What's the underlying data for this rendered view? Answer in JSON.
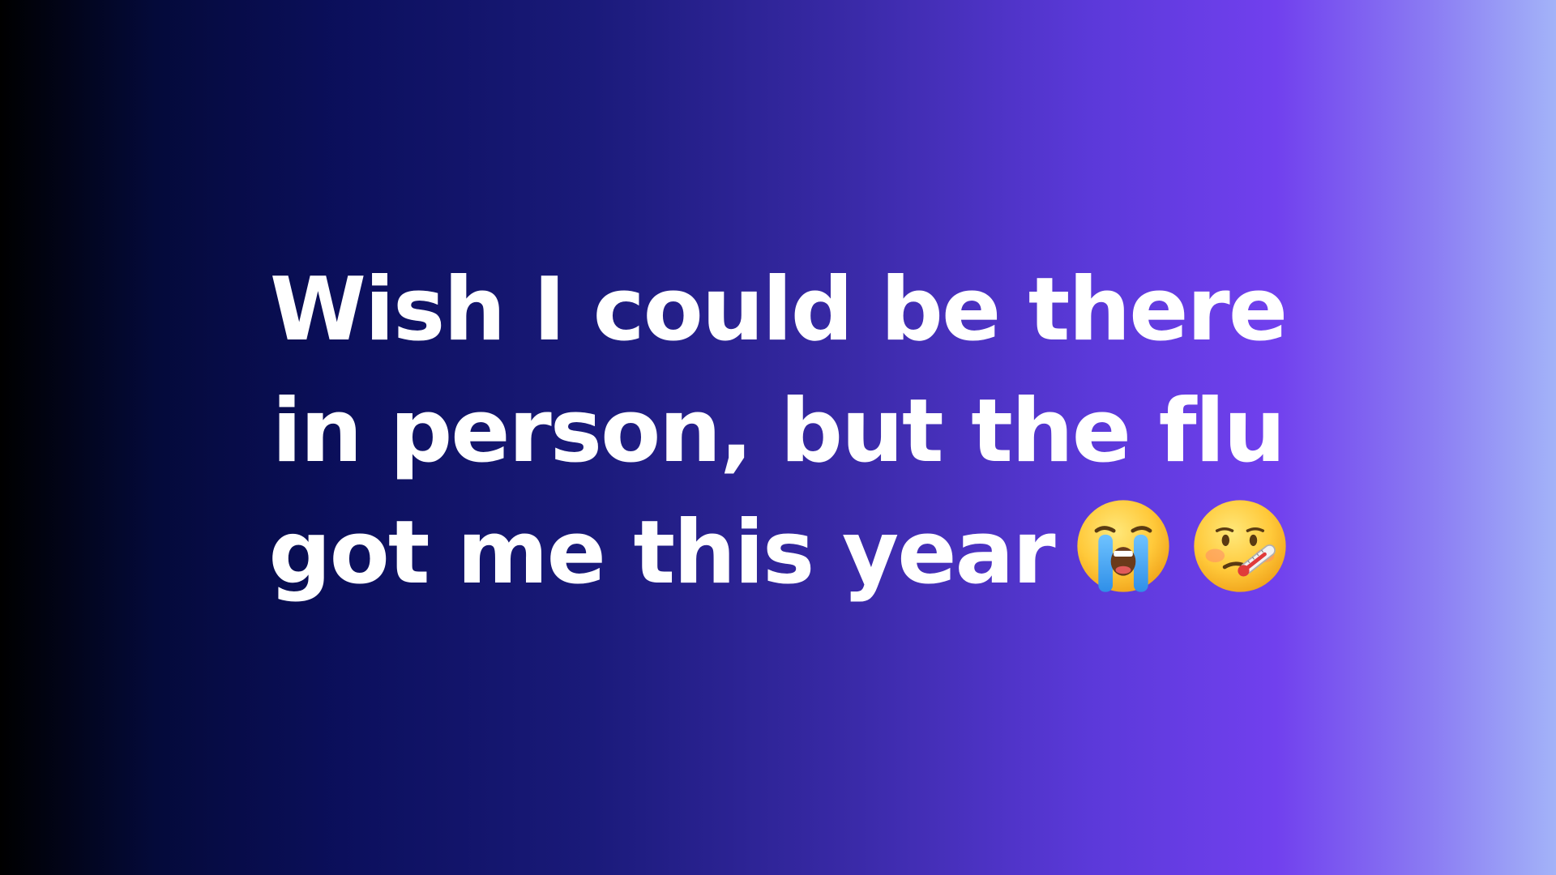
{
  "message": {
    "line1": "Wish I could be there",
    "line2": "in person, but the flu",
    "line3": "got me this year"
  },
  "emojis": [
    {
      "name": "loudly-crying-face",
      "char": "😭"
    },
    {
      "name": "face-with-thermometer",
      "char": "🤒"
    }
  ],
  "colors": {
    "text": "#ffffff",
    "gradient_left": "#000000",
    "gradient_mid": "#1a1a7a",
    "gradient_purple": "#7140ee",
    "gradient_right": "#a3b3f8"
  }
}
